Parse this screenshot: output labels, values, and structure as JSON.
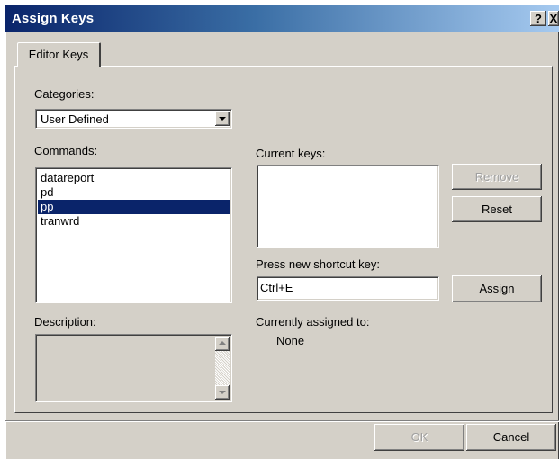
{
  "window": {
    "title": "Assign Keys",
    "help_glyph": "?",
    "close_glyph": "X"
  },
  "tabs": [
    {
      "label": "Editor Keys",
      "active": true
    }
  ],
  "categories": {
    "label": "Categories:",
    "selected": "User Defined"
  },
  "commands": {
    "label": "Commands:",
    "items": [
      "datareport",
      "pd",
      "pp",
      "tranwrd"
    ],
    "selected_index": 2
  },
  "current_keys": {
    "label": "Current keys:",
    "items": []
  },
  "buttons": {
    "remove": "Remove",
    "reset": "Reset",
    "assign": "Assign",
    "ok": "OK",
    "cancel": "Cancel"
  },
  "shortcut": {
    "label": "Press new shortcut key:",
    "value": "Ctrl+E"
  },
  "assigned_to": {
    "label": "Currently assigned to:",
    "value": "None"
  },
  "description": {
    "label": "Description:"
  }
}
